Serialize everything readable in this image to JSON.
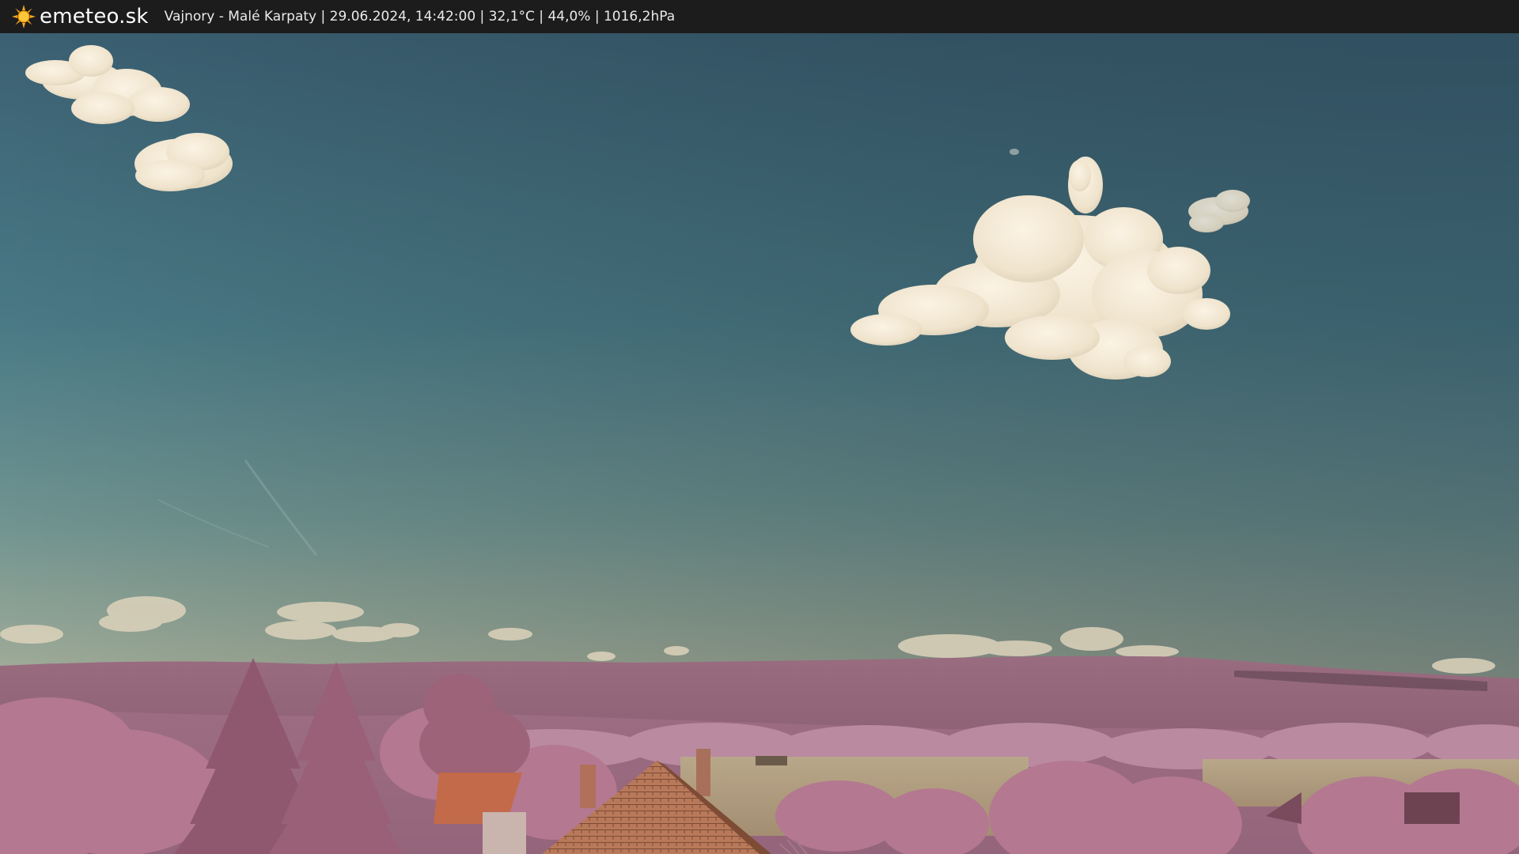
{
  "header": {
    "brand": "emeteo.sk",
    "logo_icon": "sun-icon",
    "caption": "Vajnory - Malé Karpaty | 29.06.2024, 14:42:00 | 32,1°C | 44,0% | 1016,2hPa"
  },
  "colors": {
    "bar": "#1c1c1c",
    "sun": "#f5a623",
    "sky_top": "#3e6577",
    "sky_bottom": "#8ba7a0",
    "cloud": "#f1e8d6",
    "hills": "#8c5f73",
    "foliage": "#b97a94",
    "field": "#b4a084",
    "roof": "#b26a4c"
  }
}
